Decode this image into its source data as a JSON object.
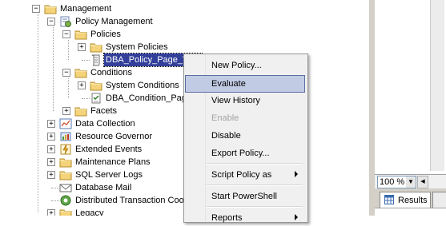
{
  "tree": {
    "items": [
      {
        "label": "Management",
        "expander": "−",
        "icon": "folder-icon"
      },
      {
        "label": "Policy Management",
        "expander": "−",
        "icon": "policy-management-icon"
      },
      {
        "label": "Policies",
        "expander": "−",
        "icon": "folder-icon"
      },
      {
        "label": "System Policies",
        "expander": "+",
        "icon": "folder-icon"
      },
      {
        "label": "DBA_Policy_Page_Verif",
        "expander": "",
        "icon": "policy-scroll-icon",
        "selected": true
      },
      {
        "label": "Conditions",
        "expander": "−",
        "icon": "folder-icon"
      },
      {
        "label": "System Conditions",
        "expander": "+",
        "icon": "folder-icon"
      },
      {
        "label": "DBA_Condition_Page_V",
        "expander": "",
        "icon": "condition-icon"
      },
      {
        "label": "Facets",
        "expander": "+",
        "icon": "folder-icon"
      },
      {
        "label": "Data Collection",
        "expander": "+",
        "icon": "data-collection-icon"
      },
      {
        "label": "Resource Governor",
        "expander": "+",
        "icon": "resource-governor-icon"
      },
      {
        "label": "Extended Events",
        "expander": "+",
        "icon": "extended-events-icon"
      },
      {
        "label": "Maintenance Plans",
        "expander": "+",
        "icon": "folder-icon"
      },
      {
        "label": "SQL Server Logs",
        "expander": "+",
        "icon": "folder-icon"
      },
      {
        "label": "Database Mail",
        "expander": "",
        "icon": "database-mail-icon"
      },
      {
        "label": "Distributed Transaction Coordin",
        "expander": "",
        "icon": "dtc-icon"
      },
      {
        "label": "Legacy",
        "expander": "+",
        "icon": "folder-icon"
      }
    ]
  },
  "context_menu": {
    "items": [
      {
        "label": "New Policy...",
        "state": "normal"
      },
      {
        "label": "Evaluate",
        "state": "highlighted"
      },
      {
        "label": "View History",
        "state": "normal"
      },
      {
        "label": "Enable",
        "state": "disabled"
      },
      {
        "label": "Disable",
        "state": "normal"
      },
      {
        "label": "Export Policy...",
        "state": "normal"
      },
      {
        "label": "Script Policy as",
        "state": "normal",
        "submenu": true
      },
      {
        "label": "Start PowerShell",
        "state": "normal"
      },
      {
        "label": "Reports",
        "state": "normal",
        "submenu": true
      }
    ]
  },
  "results_pane": {
    "zoom_value": "100 %",
    "tab_results_label": "Results"
  },
  "colors": {
    "selection": "#33409a",
    "menu_highlight": "#c1cbe3",
    "folder": "#f4d37a"
  }
}
